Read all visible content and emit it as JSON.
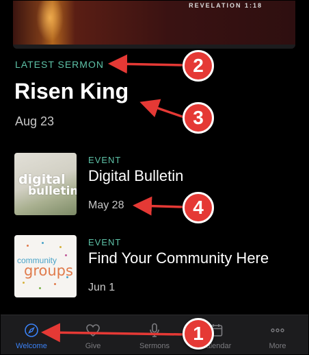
{
  "hero": {
    "scripture_ref": "REVELATION 1:18"
  },
  "latest": {
    "section_label": "LATEST SERMON",
    "title": "Risen King",
    "date": "Aug 23"
  },
  "events": [
    {
      "tag": "EVENT",
      "title": "Digital Bulletin",
      "date": "May 28",
      "thumb_line1": "digital",
      "thumb_line2": "bulletin"
    },
    {
      "tag": "EVENT",
      "title": "Find Your Community Here",
      "date": "Jun 1",
      "thumb_line1": "community",
      "thumb_line2": "groups"
    }
  ],
  "tabs": [
    {
      "label": "Welcome",
      "icon": "compass-icon",
      "active": true
    },
    {
      "label": "Give",
      "icon": "heart-icon",
      "active": false
    },
    {
      "label": "Sermons",
      "icon": "microphone-icon",
      "active": false
    },
    {
      "label": "Calendar",
      "icon": "calendar-icon",
      "active": false
    },
    {
      "label": "More",
      "icon": "more-dots-icon",
      "active": false
    }
  ],
  "callouts": [
    "1",
    "2",
    "3",
    "4"
  ],
  "colors": {
    "accent_teal": "#5ec3a8",
    "active_tab": "#3b82f6",
    "callout_red": "#e53935",
    "background": "#000000"
  }
}
